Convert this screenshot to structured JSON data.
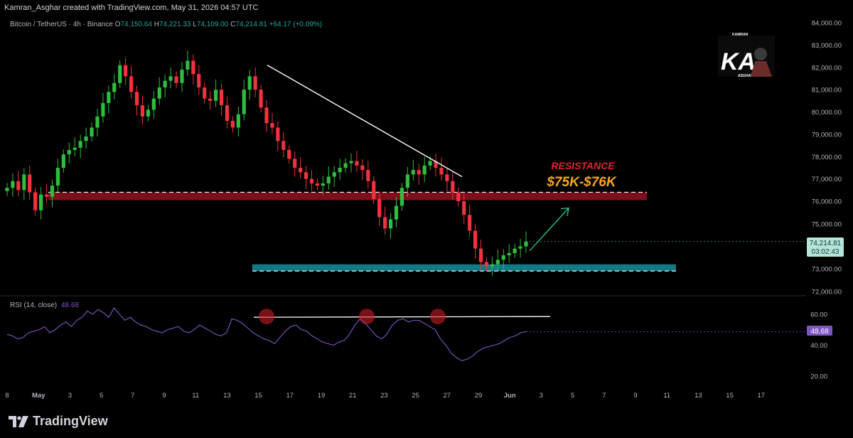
{
  "header": {
    "attribution": "Kamran_Asghar created with TradingView.com, May 31, 2026 04:57 UTC"
  },
  "legend": {
    "symbol": "Bitcoin / TetherUS · 4h · Binance",
    "open_label": "O",
    "open": "74,150.64",
    "high_label": "H",
    "high": "74,221.33",
    "low_label": "L",
    "low": "74,109.00",
    "close_label": "C",
    "close": "74,214.81",
    "change": "+64.17 (+0.09%)"
  },
  "annotations": {
    "resistance_title": "RESISTANCE",
    "resistance_range": "$75K-$76K"
  },
  "price_badge": {
    "price": "74,214.81",
    "countdown": "03:02:43"
  },
  "rsi": {
    "label": "RSI (14, close)",
    "value": "48.68",
    "badge": "48.68"
  },
  "watermark": {
    "name_top": "KAMRAN",
    "initials": "KA",
    "name_bottom": "ASGHAR"
  },
  "footer": {
    "brand": "TradingView"
  },
  "colors": {
    "up": "#26a69a",
    "up_candle": "#2ebd3f",
    "down": "#ef3340",
    "resistance_zone": "#7d0f1c",
    "support_zone": "#137a85",
    "rsi_line": "#7e57c2",
    "resistance_text": "#e4232e",
    "range_text": "#f5a623"
  },
  "chart_data": [
    {
      "type": "candlestick",
      "title": "Bitcoin / TetherUS · 4h · Binance",
      "y_ticks": [
        "84,000.00",
        "83,000.00",
        "82,000.00",
        "81,000.00",
        "80,000.00",
        "79,000.00",
        "78,000.00",
        "77,000.00",
        "76,000.00",
        "75,000.00",
        "73,000.00",
        "72,000.00"
      ],
      "x_ticks": [
        "8",
        "May",
        "3",
        "5",
        "7",
        "9",
        "11",
        "13",
        "15",
        "17",
        "19",
        "21",
        "23",
        "25",
        "27",
        "29",
        "Jun",
        "3",
        "5",
        "7",
        "9",
        "11",
        "13",
        "15",
        "17"
      ],
      "ylim": [
        72000,
        84000
      ],
      "resistance_zone": [
        76050,
        76400
      ],
      "support_zone": [
        72900,
        73200
      ],
      "closes": [
        76600,
        76900,
        76500,
        77200,
        76400,
        75600,
        76300,
        76200,
        76700,
        77500,
        78100,
        78300,
        78400,
        78700,
        78900,
        79300,
        79800,
        80400,
        80900,
        81300,
        82100,
        81600,
        80900,
        80300,
        79800,
        80100,
        80600,
        81100,
        81400,
        81600,
        81300,
        81900,
        82300,
        81700,
        81100,
        80600,
        80500,
        81000,
        80300,
        79600,
        79300,
        79900,
        81000,
        81600,
        81000,
        80200,
        79500,
        79300,
        78700,
        78300,
        77900,
        77500,
        77300,
        77000,
        76800,
        76700,
        76800,
        77100,
        77300,
        77500,
        77700,
        77800,
        77600,
        77400,
        76900,
        76100,
        75300,
        74800,
        75200,
        75800,
        76600,
        77200,
        77400,
        77200,
        77600,
        77800,
        77500,
        77200,
        76900,
        76400,
        76000,
        75400,
        74700,
        73900,
        73300,
        73100,
        73200,
        73400,
        73600,
        73700,
        73900,
        74000,
        74214.81
      ],
      "trendline": {
        "from": {
          "x": "May 14",
          "y": 82100
        },
        "to": {
          "x": "May 26",
          "y": 77100
        }
      },
      "forecast_arrow": {
        "from": {
          "x": "May 30",
          "y": 73800
        },
        "to": {
          "x": "Jun 1",
          "y": 75700
        }
      },
      "last_price": 74214.81
    },
    {
      "type": "line",
      "title": "RSI (14, close)",
      "y_ticks": [
        "60.00",
        "40.00",
        "20.00"
      ],
      "ylim": [
        15,
        70
      ],
      "level_line": 58,
      "peak_markers": 3,
      "values": [
        47,
        46,
        44,
        45,
        48,
        49,
        50,
        52,
        48,
        50,
        53,
        55,
        52,
        56,
        58,
        62,
        60,
        63,
        61,
        58,
        64,
        60,
        56,
        58,
        55,
        53,
        52,
        50,
        49,
        48,
        50,
        51,
        52,
        49,
        48,
        50,
        53,
        51,
        49,
        47,
        46,
        48,
        57,
        56,
        54,
        51,
        48,
        46,
        44,
        43,
        41,
        45,
        49,
        52,
        53,
        50,
        49,
        46,
        44,
        42,
        41,
        40,
        42,
        43,
        47,
        53,
        57,
        54,
        50,
        46,
        44,
        47,
        53,
        56,
        57,
        55,
        56,
        56,
        54,
        52,
        50,
        44,
        40,
        35,
        32,
        30,
        31,
        33,
        36,
        38,
        39,
        40,
        41,
        43,
        45,
        46,
        48,
        48.68
      ],
      "last_value": 48.68
    }
  ]
}
